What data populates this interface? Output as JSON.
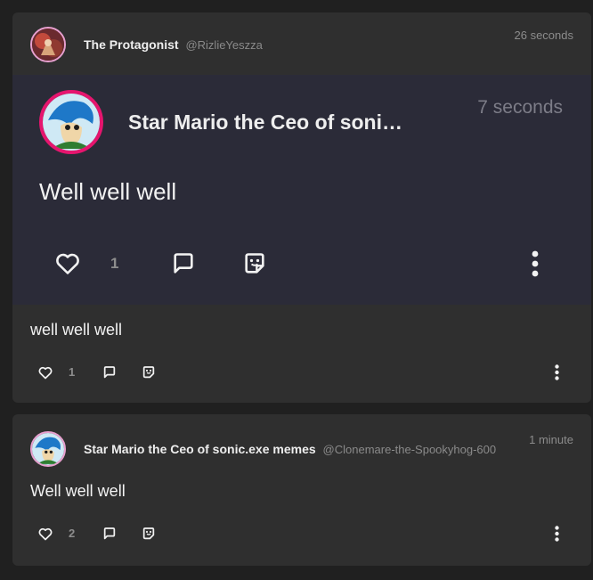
{
  "posts": [
    {
      "author": {
        "display_name": "The Protagonist",
        "handle": "@RizlieYeszza"
      },
      "timestamp": "26 seconds",
      "text": "well well well",
      "likes": "1",
      "quoted": {
        "author": {
          "display_name": "Star Mario the Ceo of soni…"
        },
        "timestamp": "7 seconds",
        "text": "Well well well",
        "likes": "1"
      }
    },
    {
      "author": {
        "display_name": "Star Mario the Ceo of sonic.exe memes",
        "handle": "@Clonemare-the-Spookyhog-600"
      },
      "timestamp": "1 minute",
      "text": "Well well well",
      "likes": "2"
    }
  ],
  "icons": {
    "like": "heart-icon",
    "reply": "speech-bubble-icon",
    "quote": "sticker-icon",
    "more": "vertical-dots-icon"
  },
  "colors": {
    "page_background": "#202020",
    "card_background": "#2f2f2f",
    "quote_background": "#2b2b38",
    "avatar_ring_pink": "#e6156e",
    "avatar_ring_light": "#e8a0cf"
  }
}
